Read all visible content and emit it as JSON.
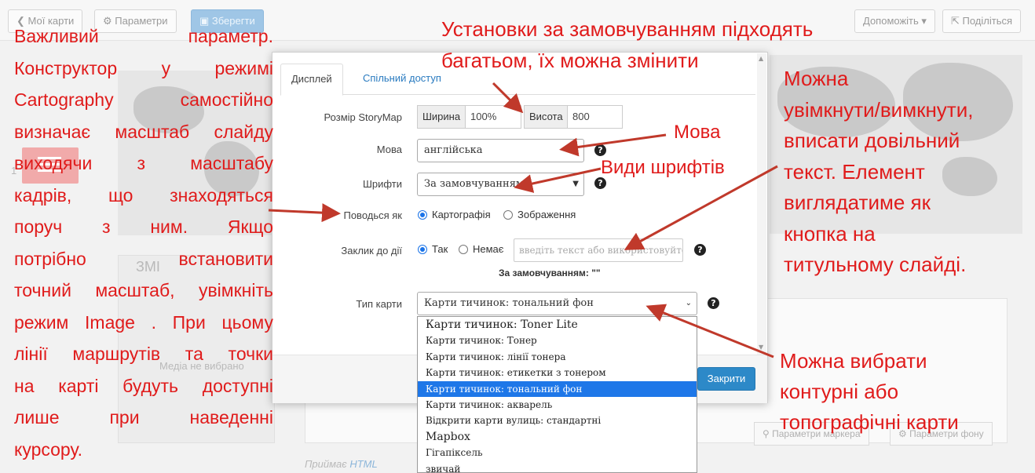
{
  "topbar": {
    "my_maps": "Мої карти",
    "settings": "Параметри",
    "save": "Зберегти",
    "help": "Допоможіть",
    "share": "Поділіться"
  },
  "background": {
    "media_none": "Медіа не вибрано",
    "accepts": "Приймає",
    "html": "HTML",
    "marker_params": "Параметри маркера",
    "bg_params": "Параметри фону",
    "slide_num": "1",
    "card_title": "ЗМІ"
  },
  "modal": {
    "tabs": [
      "Дисплей",
      "Спільний доступ"
    ],
    "size_label": "Розмір StoryMap",
    "width_label": "Ширина",
    "width_value": "100%",
    "height_label": "Висота",
    "height_value": "800",
    "language_label": "Мова",
    "language_value": "англійська",
    "fonts_label": "Шрифти",
    "fonts_value": "За замовчуванням",
    "behaves_label": "Поводься як",
    "behaves_options": [
      "Картографія",
      "Зображення"
    ],
    "cta_label": "Заклик до дії",
    "cta_options": [
      "Так",
      "Немає"
    ],
    "cta_placeholder": "введіть текст або використовуйте",
    "cta_default": "За замовчуванням: \"\"",
    "map_type_label": "Тип карти",
    "map_type_value": "Карти тичинок: тональний фон",
    "close": "Закрити",
    "help_glyph": "?"
  },
  "dropdown": {
    "options": [
      "Карти тичинок: Toner Lite",
      "Карти тичинок: Тонер",
      "Карти тичинок: лінії тонера",
      "Карти тичинок: етикетки з тонером",
      "Карти тичинок: тональний фон",
      "Карти тичинок: акварель",
      "Відкрити карти вулиць: стандартні",
      "Mapbox",
      "Гігапіксель",
      "звичай"
    ],
    "selected_index": 4
  },
  "annotations": {
    "left_lines": [
      "Важливий параметр.",
      "Конструктор у режимі",
      "Cartography самостійно",
      "визначає масштаб слайду",
      "виходячи з масштабу",
      "кадрів, що знаходяться",
      "поруч з ним. Якщо",
      "потрібно встановити",
      "точний масштаб, увімкніть",
      "режим Image . При цьому",
      "лінії маршрутів та точки",
      "на карті будуть доступні",
      "лише при наведенні",
      "курсору."
    ],
    "defaults_line1": "Установки за замовчуванням підходять",
    "defaults_line2": "багатьом, їх можна змінити",
    "language": "Мова",
    "fonts": "Види шрифтів",
    "cta_lines": [
      "Можна",
      "увімкнути/вимкнути,",
      "вписати довільний",
      "текст. Елемент",
      "виглядатиме як",
      "кнопка на",
      "титульному  слайді."
    ],
    "map_type_lines": [
      "Можна вибрати",
      "контурні або",
      "топографічні карти"
    ]
  },
  "colors": {
    "annotation_red": "#e01b1b",
    "primary_blue": "#2d89c8",
    "selected_option": "#1e77e8"
  }
}
